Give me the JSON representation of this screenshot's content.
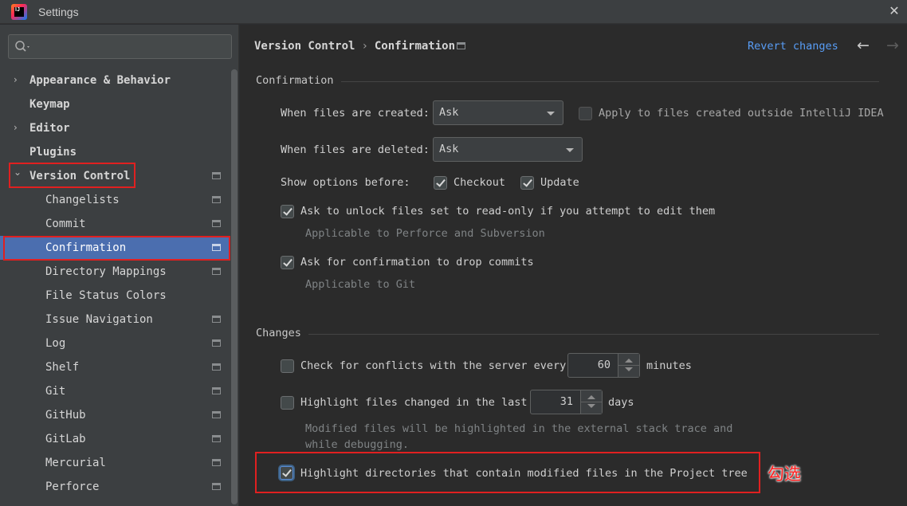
{
  "window": {
    "app_icon_text": "IJ",
    "title": "Settings",
    "close_glyph": "✕"
  },
  "sidebar": {
    "search_placeholder": "",
    "items": [
      {
        "label": "Appearance & Behavior",
        "arrow": "›",
        "bold": true,
        "has_proj": false
      },
      {
        "label": "Keymap",
        "arrow": "",
        "bold": true,
        "has_proj": false
      },
      {
        "label": "Editor",
        "arrow": "›",
        "bold": true,
        "has_proj": false
      },
      {
        "label": "Plugins",
        "arrow": "",
        "bold": true,
        "has_proj": false
      },
      {
        "label": "Version Control",
        "arrow": "⌄",
        "bold": true,
        "has_proj": true
      },
      {
        "label": "Changelists",
        "arrow": "",
        "bold": false,
        "has_proj": true
      },
      {
        "label": "Commit",
        "arrow": "",
        "bold": false,
        "has_proj": true
      },
      {
        "label": "Confirmation",
        "arrow": "",
        "bold": false,
        "has_proj": true,
        "selected": true
      },
      {
        "label": "Directory Mappings",
        "arrow": "",
        "bold": false,
        "has_proj": true
      },
      {
        "label": "File Status Colors",
        "arrow": "",
        "bold": false,
        "has_proj": false
      },
      {
        "label": "Issue Navigation",
        "arrow": "",
        "bold": false,
        "has_proj": true
      },
      {
        "label": "Log",
        "arrow": "",
        "bold": false,
        "has_proj": true
      },
      {
        "label": "Shelf",
        "arrow": "",
        "bold": false,
        "has_proj": true
      },
      {
        "label": "Git",
        "arrow": "",
        "bold": false,
        "has_proj": true
      },
      {
        "label": "GitHub",
        "arrow": "",
        "bold": false,
        "has_proj": true
      },
      {
        "label": "GitLab",
        "arrow": "",
        "bold": false,
        "has_proj": true
      },
      {
        "label": "Mercurial",
        "arrow": "",
        "bold": false,
        "has_proj": true
      },
      {
        "label": "Perforce",
        "arrow": "",
        "bold": false,
        "has_proj": true
      }
    ]
  },
  "header": {
    "crumb_parent": "Version Control",
    "crumb_sep": "›",
    "crumb_current": "Confirmation",
    "revert": "Revert changes",
    "back": "←",
    "forward": "→"
  },
  "confirmation": {
    "section_title": "Confirmation",
    "files_created_label": "When files are created:",
    "files_created_value": "Ask",
    "apply_outside_label": "Apply to files created outside IntelliJ IDEA",
    "apply_outside_checked": false,
    "files_deleted_label": "When files are deleted:",
    "files_deleted_value": "Ask",
    "show_options_label": "Show options before:",
    "checkout_label": "Checkout",
    "checkout_checked": true,
    "update_label": "Update",
    "update_checked": true,
    "unlock_label": "Ask to unlock files set to read-only if you attempt to edit them",
    "unlock_checked": true,
    "unlock_hint": "Applicable to Perforce and Subversion",
    "drop_commits_label": "Ask for confirmation to drop commits",
    "drop_commits_checked": true,
    "drop_commits_hint": "Applicable to Git"
  },
  "changes": {
    "section_title": "Changes",
    "conflicts_label": "Check for conflicts with the server every",
    "conflicts_checked": false,
    "conflicts_value": "60",
    "conflicts_unit": "minutes",
    "highlight_changed_label": "Highlight files changed in the last",
    "highlight_changed_checked": false,
    "highlight_changed_value": "31",
    "highlight_changed_unit": "days",
    "highlight_hint_line1": "Modified files will be highlighted in the external stack trace and",
    "highlight_hint_line2": "while debugging.",
    "highlight_dirs_label": "Highlight directories that contain modified files in the Project tree",
    "highlight_dirs_checked": true
  },
  "annotation": "勾选",
  "colors": {
    "accent": "#4b6eaf",
    "link": "#589df6",
    "highlight_box": "#e02020"
  }
}
